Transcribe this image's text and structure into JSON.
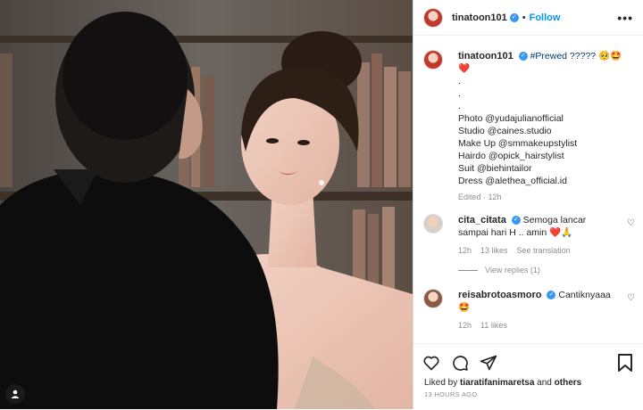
{
  "post": {
    "username": "tinatoon101",
    "follow_label": "Follow",
    "more_label": "•••",
    "caption": {
      "username": "tinatoon101",
      "hashtag_text": "#Prewed ????? 🥺🤩",
      "heart": "❤️",
      "dots": [
        ".",
        ".",
        "."
      ],
      "credits": [
        "Photo @yudajulianofficial",
        "Studio @caines.studio",
        "Make Up @smmakeupstylist",
        "Hairdo @opick_hairstylist",
        "Suit @biehintailor",
        "Dress @alethea_official.id"
      ],
      "meta": "Edited · 12h"
    },
    "comments": [
      {
        "username": "cita_citata",
        "text": "Semoga lancar sampai hari H .. amin ❤️🙏",
        "time": "12h",
        "likes": "13 likes",
        "extra": "See translation",
        "view_replies": "View replies (1)"
      },
      {
        "username": "reisabrotoasmoro",
        "text": "Cantiknyaaa 🤩",
        "time": "12h",
        "likes": "11 likes"
      }
    ],
    "liked_by_prefix": "Liked by ",
    "liked_by_user": "tiaratifanimaretsa",
    "liked_by_suffix": " and ",
    "liked_by_others": "others",
    "timestamp": "13 HOURS AGO"
  },
  "colors": {
    "accent": "#0095f6",
    "verified": "#3897f0",
    "muted": "#8e8e8e"
  }
}
